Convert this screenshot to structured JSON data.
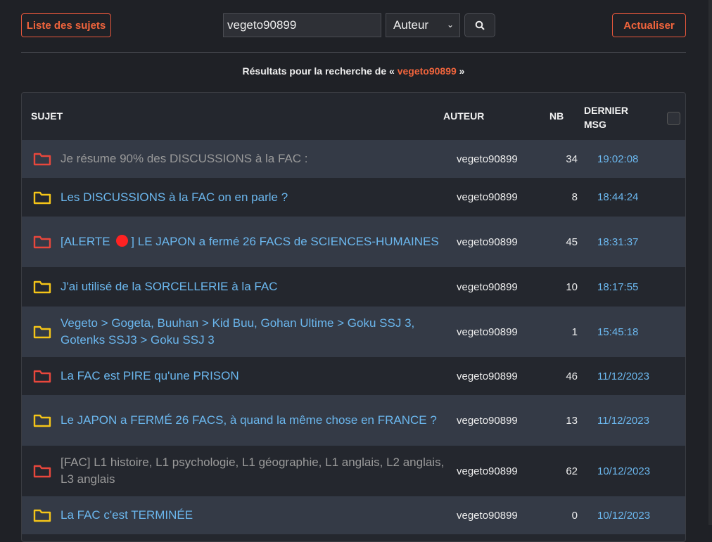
{
  "toolbar": {
    "list_label": "Liste des sujets",
    "search_value": "vegeto90899",
    "select_value": "Auteur",
    "refresh_label": "Actualiser"
  },
  "results": {
    "prefix": "Résultats pour la recherche de « ",
    "query": "vegeto90899",
    "suffix": " »"
  },
  "table": {
    "headers": {
      "subject": "SUJET",
      "author": "AUTEUR",
      "nb": "NB",
      "last_line1": "DERNIER",
      "last_line2": "MSG"
    },
    "rows": [
      {
        "title": "Je résume 90% des DISCUSSIONS à la FAC :",
        "author": "vegeto90899",
        "nb": "34",
        "last": "19:02:08",
        "folder": "red",
        "visited": true
      },
      {
        "title": "Les DISCUSSIONS à la FAC on en parle ?",
        "author": "vegeto90899",
        "nb": "8",
        "last": "18:44:24",
        "folder": "yellow",
        "visited": false
      },
      {
        "title_pre": "[ALERTE",
        "title_post": "] LE JAPON a fermé 26 FACS de SCIENCES-HUMAINES",
        "author": "vegeto90899",
        "nb": "45",
        "last": "18:31:37",
        "folder": "red",
        "visited": false
      },
      {
        "title": "J'ai utilisé de la SORCELLERIE à la FAC",
        "author": "vegeto90899",
        "nb": "10",
        "last": "18:17:55",
        "folder": "yellow",
        "visited": false
      },
      {
        "title": "Vegeto > Gogeta, Buuhan > Kid Buu, Gohan Ultime > Goku SSJ 3, Gotenks SSJ3 > Goku SSJ 3",
        "author": "vegeto90899",
        "nb": "1",
        "last": "15:45:18",
        "folder": "yellow",
        "visited": false
      },
      {
        "title": "La FAC est PIRE qu'une PRISON",
        "author": "vegeto90899",
        "nb": "46",
        "last": "11/12/2023",
        "folder": "red",
        "visited": false
      },
      {
        "title": "Le JAPON a FERMÉ 26 FACS, à quand la même chose en FRANCE ?",
        "author": "vegeto90899",
        "nb": "13",
        "last": "11/12/2023",
        "folder": "yellow",
        "visited": false
      },
      {
        "title": "[FAC] L1 histoire, L1 psychologie, L1 géographie, L1 anglais, L2 anglais, L3 anglais",
        "author": "vegeto90899",
        "nb": "62",
        "last": "10/12/2023",
        "folder": "red",
        "visited": true
      },
      {
        "title": "La FAC c'est TERMINÉE",
        "author": "vegeto90899",
        "nb": "0",
        "last": "10/12/2023",
        "folder": "yellow",
        "visited": false
      }
    ]
  },
  "colors": {
    "accent": "#f0643c",
    "link": "#6bb7ee",
    "folder_red": "#e8473c",
    "folder_yellow": "#f5c518"
  }
}
